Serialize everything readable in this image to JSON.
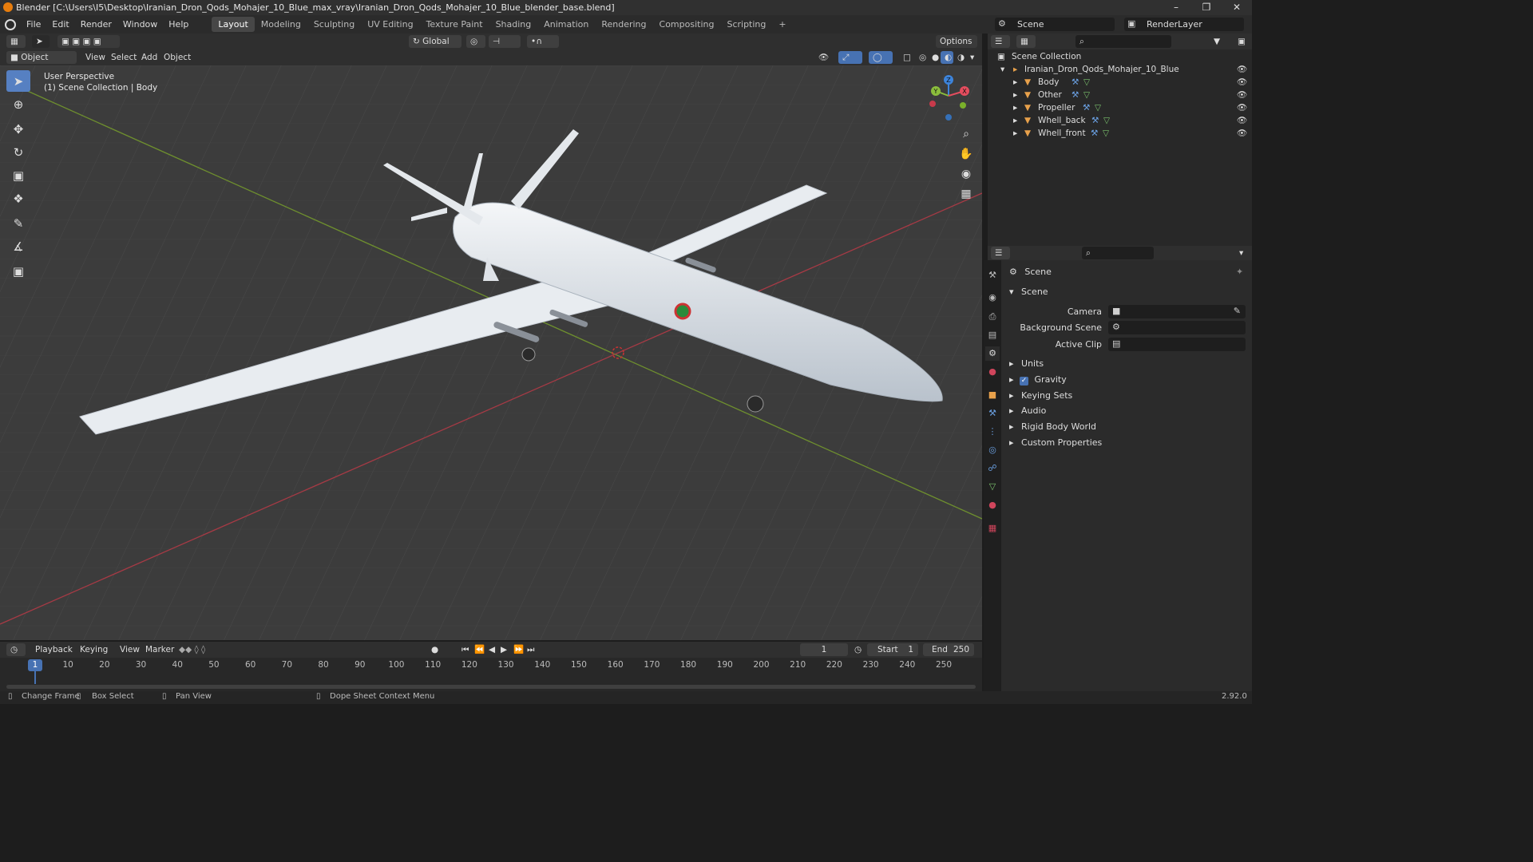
{
  "window": {
    "title": "Blender [C:\\Users\\I5\\Desktop\\Iranian_Dron_Qods_Mohajer_10_Blue_max_vray\\Iranian_Dron_Qods_Mohajer_10_Blue_blender_base.blend]"
  },
  "menubar": {
    "items": [
      "File",
      "Edit",
      "Render",
      "Window",
      "Help"
    ],
    "workspaces": [
      "Layout",
      "Modeling",
      "Sculpting",
      "UV Editing",
      "Texture Paint",
      "Shading",
      "Animation",
      "Rendering",
      "Compositing",
      "Scripting"
    ],
    "active_workspace": "Layout",
    "add_tab": "+",
    "scene": "Scene",
    "render_layer": "RenderLayer"
  },
  "viewport_header": {
    "transform_orientation": "Global",
    "options": "Options",
    "mode": "Object Mode",
    "menus": [
      "View",
      "Select",
      "Add",
      "Object"
    ]
  },
  "viewport": {
    "view_name": "User Perspective",
    "collection_info": "(1) Scene Collection | Body",
    "gizmo_axes": [
      "Z",
      "Y",
      "X"
    ]
  },
  "outliner": {
    "root": "Scene Collection",
    "collection": "Iranian_Dron_Qods_Mohajer_10_Blue",
    "objects": [
      "Body",
      "Other",
      "Propeller",
      "Whell_back",
      "Whell_front"
    ]
  },
  "properties": {
    "context": "Scene",
    "panel": "Scene",
    "fields": [
      {
        "label": "Camera",
        "value": ""
      },
      {
        "label": "Background Scene",
        "value": ""
      },
      {
        "label": "Active Clip",
        "value": ""
      }
    ],
    "subpanels": [
      "Units",
      "Gravity",
      "Keying Sets",
      "Audio",
      "Rigid Body World",
      "Custom Properties"
    ],
    "gravity_checked": true
  },
  "timeline": {
    "menus": [
      "Playback",
      "Keying",
      "View",
      "Marker"
    ],
    "current_frame": "1",
    "start_label": "Start",
    "start": "1",
    "end_label": "End",
    "end": "250",
    "ticks": [
      "1",
      "10",
      "20",
      "30",
      "40",
      "50",
      "60",
      "70",
      "80",
      "90",
      "100",
      "110",
      "120",
      "130",
      "140",
      "150",
      "160",
      "170",
      "180",
      "190",
      "200",
      "210",
      "220",
      "230",
      "240",
      "250"
    ]
  },
  "statusbar": {
    "hints": [
      "Change Frame",
      "Box Select",
      "Pan View",
      "Dope Sheet Context Menu"
    ],
    "version": "2.92.0"
  },
  "colors": {
    "accent": "#5680c2",
    "active_frame": "#4772b3",
    "axis_x": "#e44d5e",
    "axis_y": "#8bbe3c",
    "axis_z": "#3d84db"
  }
}
